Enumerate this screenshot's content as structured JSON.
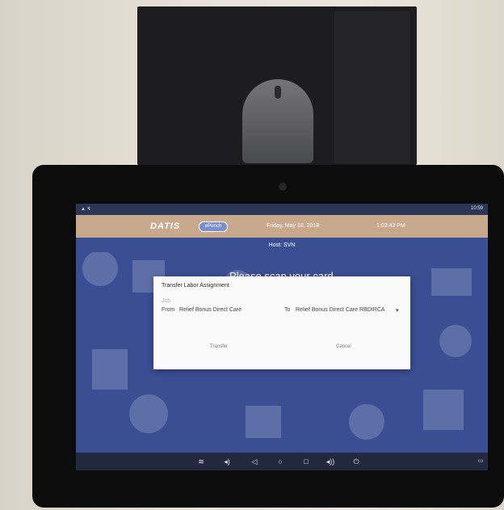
{
  "status_bar": {
    "left_icons": "▲ ↯",
    "right_text": "10:59"
  },
  "app_bar": {
    "logo": "DATIS",
    "pill_label": "ePunch",
    "date": "Friday, May 18, 2018",
    "time": "1:03:43 PM"
  },
  "host": "Host: SVN",
  "prompt": "Please scan your card",
  "dialog": {
    "title": "Transfer Labor Assignment",
    "job_label": "Job",
    "from_label": "From",
    "from_value": "Relief Bonus Direct Care",
    "to_label": "To",
    "to_value": "Relief Bonus Direct Care  RBDIRCA",
    "transfer_label": "Transfer",
    "cancel_label": "Cancel"
  },
  "nav_icons": [
    "chevrons-down-icon",
    "volume-down-icon",
    "back-icon",
    "home-icon",
    "recents-icon",
    "volume-up-icon",
    "power-icon"
  ],
  "colors": {
    "screen_bg": "#3b4e94",
    "app_bar": "#c8a98e",
    "dialog_bg": "#fafafa"
  }
}
